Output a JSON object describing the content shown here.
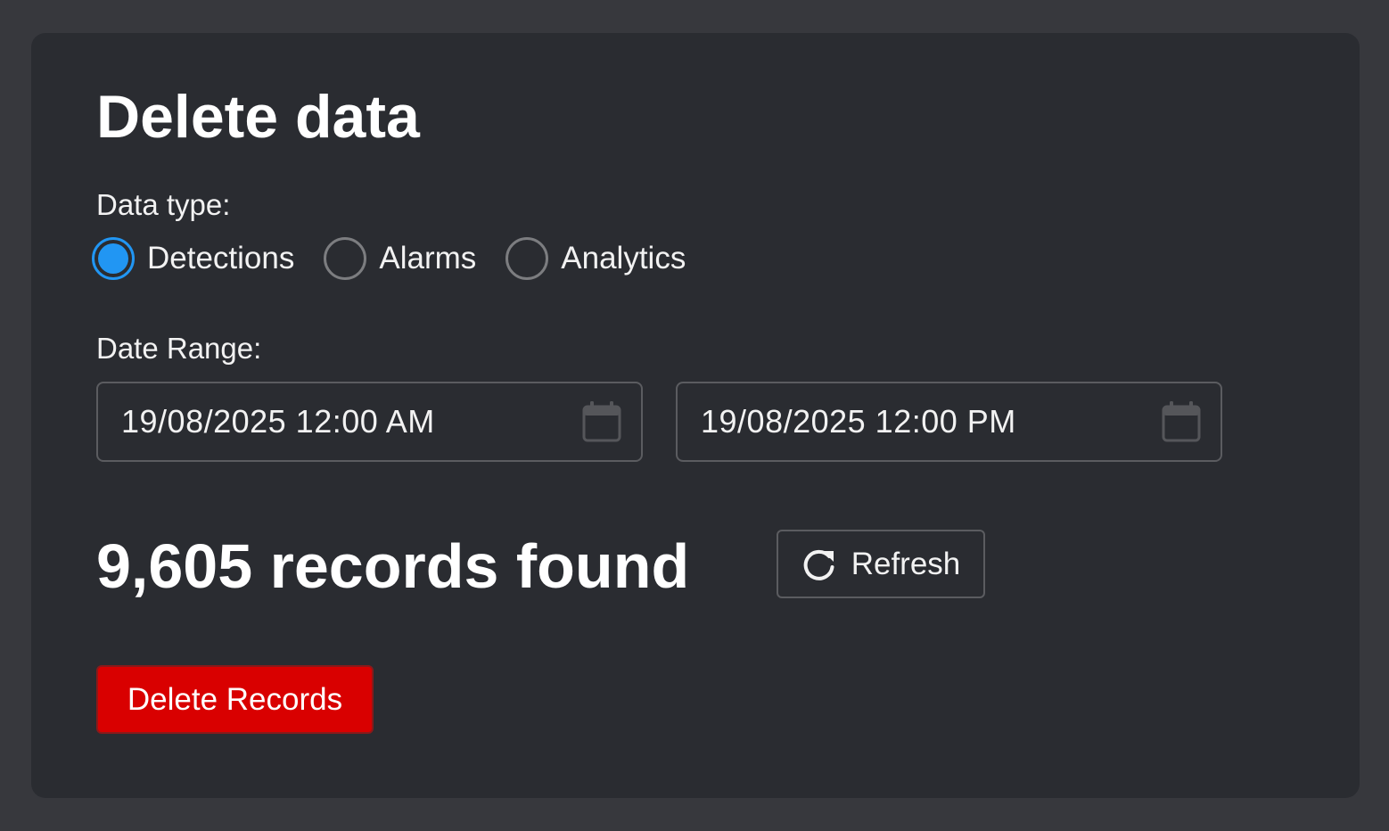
{
  "title": "Delete data",
  "data_type": {
    "label": "Data type:",
    "options": [
      {
        "label": "Detections",
        "selected": true
      },
      {
        "label": "Alarms",
        "selected": false
      },
      {
        "label": "Analytics",
        "selected": false
      }
    ]
  },
  "date_range": {
    "label": "Date Range:",
    "start": "19/08/2025 12:00 AM",
    "end": "19/08/2025 12:00 PM",
    "icon": "calendar-icon"
  },
  "records": {
    "text": "9,605 records found"
  },
  "refresh_button": {
    "label": "Refresh",
    "icon": "refresh-icon"
  },
  "delete_button": {
    "label": "Delete Records"
  },
  "colors": {
    "accent": "#2196f3",
    "danger": "#d90000",
    "card_background": "#2a2c31",
    "page_background": "#37383d"
  }
}
